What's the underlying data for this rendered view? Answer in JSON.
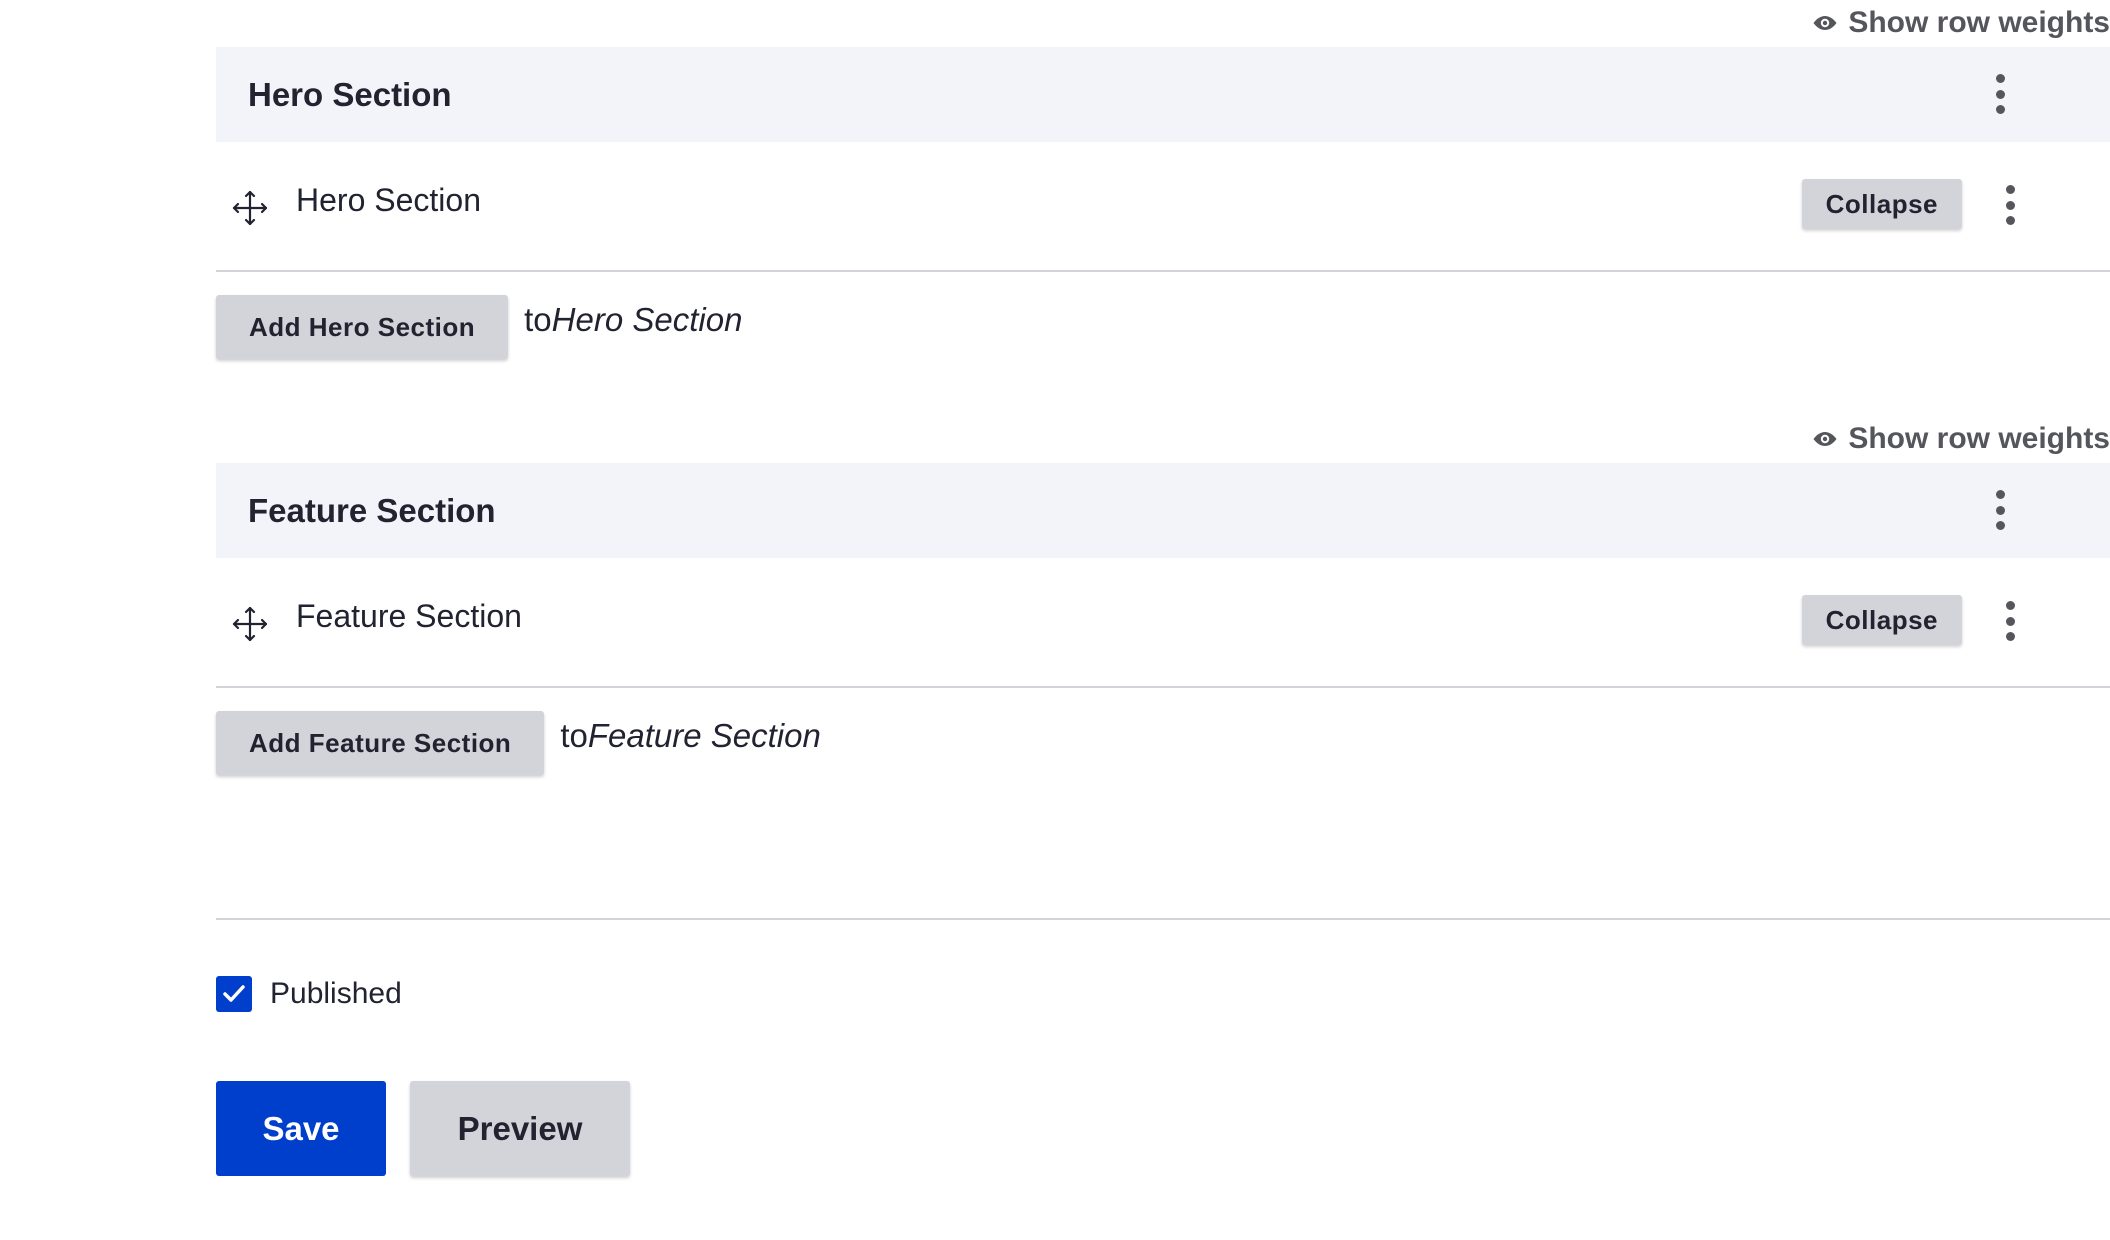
{
  "fields": {
    "hero": {
      "row_weights_label": "Show row weights",
      "table_header": "Hero Section",
      "row_label": "Hero Section",
      "collapse_label": "Collapse",
      "add_button_label": "Add Hero Section",
      "add_to_prefix": "to",
      "add_to_target": "Hero Section"
    },
    "feature": {
      "row_weights_label": "Show row weights",
      "table_header": "Feature Section",
      "row_label": "Feature Section",
      "collapse_label": "Collapse",
      "add_button_label": "Add Feature Section",
      "add_to_prefix": "to",
      "add_to_target": "Feature Section"
    }
  },
  "published": {
    "label": "Published",
    "checked": true
  },
  "actions": {
    "save_label": "Save",
    "preview_label": "Preview"
  },
  "icons": {
    "row_weights": "eye-icon",
    "drag": "move-arrows-icon",
    "operations": "kebab-menu-icon",
    "checkbox": "checkmark-icon"
  },
  "colors": {
    "primary": "#003ecc",
    "button_gray": "#d3d4d9",
    "table_header_bg": "#f3f4f9",
    "text": "#222330",
    "muted": "#55565b"
  }
}
